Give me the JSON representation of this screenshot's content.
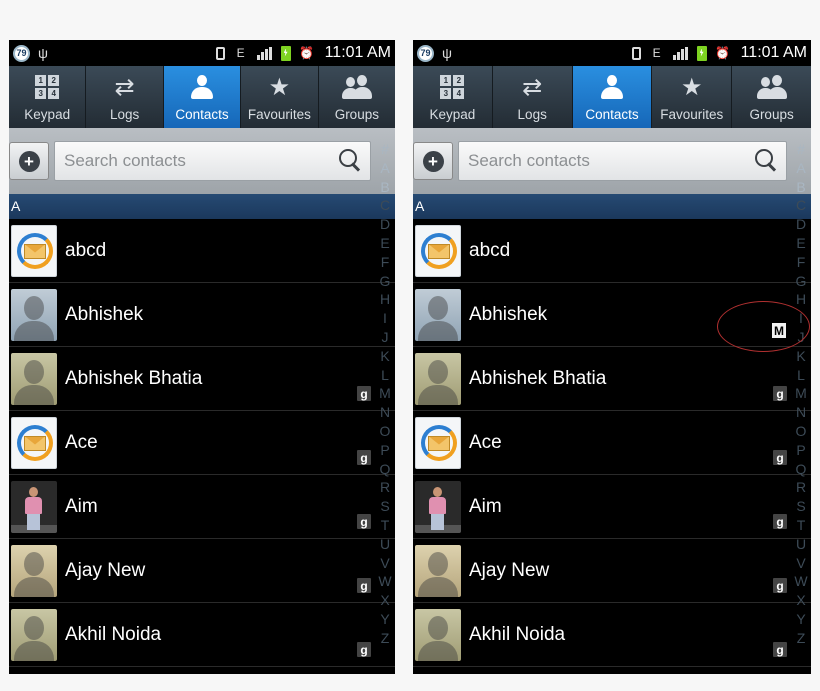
{
  "status": {
    "battery_badge": "79",
    "usb": "ψ",
    "network": "E",
    "time": "11:01 AM"
  },
  "tabs": [
    {
      "label": "Keypad",
      "icon": "keypad-icon",
      "keys": [
        "1",
        "2",
        "3",
        "4"
      ]
    },
    {
      "label": "Logs",
      "icon": "logs-icon",
      "glyph": "⇄"
    },
    {
      "label": "Contacts",
      "icon": "contacts-icon",
      "active": true
    },
    {
      "label": "Favourites",
      "icon": "star-icon",
      "glyph": "★"
    },
    {
      "label": "Groups",
      "icon": "groups-icon"
    }
  ],
  "search": {
    "add_button": "+",
    "placeholder": "Search contacts"
  },
  "section_letter": "A",
  "contacts": [
    {
      "name": "abcd",
      "avatar": "app-avatar",
      "google": false
    },
    {
      "name": "Abhishek",
      "avatar": "silhouette-blue",
      "google": false
    },
    {
      "name": "Abhishek Bhatia",
      "avatar": "silhouette-olive",
      "google": true
    },
    {
      "name": "Ace",
      "avatar": "app-avatar",
      "google": true
    },
    {
      "name": "Aim",
      "avatar": "photo",
      "google": true
    },
    {
      "name": "Ajay New",
      "avatar": "silhouette-tan",
      "google": true
    },
    {
      "name": "Akhil Noida",
      "avatar": "silhouette-olive",
      "google": true
    }
  ],
  "google_badge": "g",
  "index_letters": [
    "#",
    "A",
    "B",
    "C",
    "D",
    "E",
    "F",
    "G",
    "H",
    "I",
    "J",
    "K",
    "L",
    "M",
    "N",
    "O",
    "P",
    "Q",
    "R",
    "S",
    "T",
    "U",
    "V",
    "W",
    "X",
    "Y",
    "Z"
  ],
  "index_highlighted": [
    "#",
    "A",
    "B"
  ],
  "popup_letter": "M",
  "colors": {
    "active_tab": "#1e7bd0",
    "section_header": "#1f3f66",
    "highlight_ring": "#b03030"
  }
}
